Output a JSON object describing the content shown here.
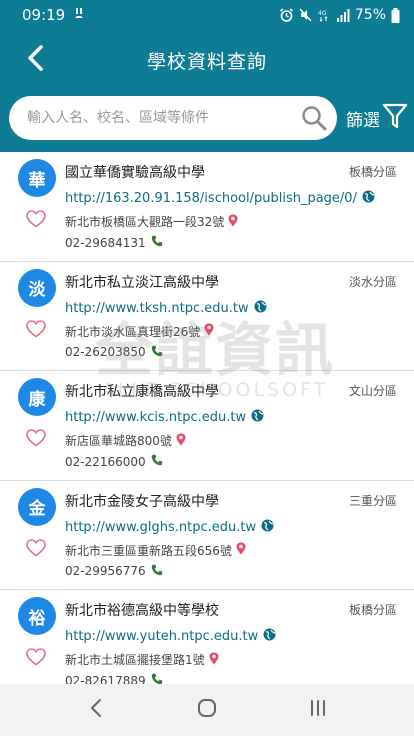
{
  "status_bar": {
    "time": "09:19",
    "battery": "75%",
    "icons": [
      "notification-icon",
      "alarm-icon",
      "mute-icon",
      "4g-icon",
      "signal-icon",
      "battery-icon"
    ]
  },
  "header": {
    "title": "學校資料查詢",
    "back_icon": "chevron-left-icon"
  },
  "search": {
    "placeholder": "輸入人名、校名、區域等條件",
    "value": "",
    "filter_label": "篩選"
  },
  "colors": {
    "header_bg": "#0f7c96",
    "avatar_bg": "#1e88e5",
    "heart": "#e76f8a",
    "link": "#0d6c86",
    "phone_icon": "#2e7d32",
    "pin_icon": "#e84a6a"
  },
  "schools": [
    {
      "initial": "華",
      "name": "國立華僑實驗高級中學",
      "district": "板橋分區",
      "url": "http://163.20.91.158/ischool/publish_page/0/",
      "address": "新北市板橋區大觀路一段32號",
      "phone": "02-29684131"
    },
    {
      "initial": "淡",
      "name": "新北市私立淡江高級中學",
      "district": "淡水分區",
      "url": "http://www.tksh.ntpc.edu.tw",
      "address": "新北市淡水區真理街26號",
      "phone": "02-26203850"
    },
    {
      "initial": "康",
      "name": "新北市私立康橋高級中學",
      "district": "文山分區",
      "url": "http://www.kcis.ntpc.edu.tw",
      "address": "新店區華城路800號",
      "phone": "02-22166000"
    },
    {
      "initial": "金",
      "name": "新北市金陵女子高級中學",
      "district": "三重分區",
      "url": "http://www.glghs.ntpc.edu.tw",
      "address": "新北市三重區重新路五段656號",
      "phone": "02-29956776"
    },
    {
      "initial": "裕",
      "name": "新北市裕德高級中等學校",
      "district": "板橋分區",
      "url": "http://www.yuteh.ntpc.edu.tw",
      "address": "新北市土城區擺接堡路1號",
      "phone": "02-82617889"
    }
  ],
  "watermark": {
    "cn": "全誼資訊",
    "en": "ALLE SCHOOLSOFT"
  },
  "nav": {
    "icons": [
      "back-nav-icon",
      "home-nav-icon",
      "recents-nav-icon"
    ]
  }
}
